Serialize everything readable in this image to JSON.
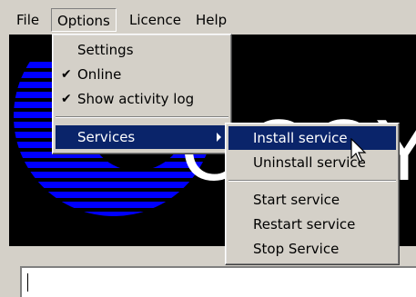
{
  "menubar": {
    "items": [
      {
        "label": "File"
      },
      {
        "label": "Options"
      },
      {
        "label": "Licence"
      },
      {
        "label": "Help"
      }
    ]
  },
  "options_menu": {
    "items": [
      {
        "label": "Settings",
        "checked": false
      },
      {
        "label": "Online",
        "checked": true
      },
      {
        "label": "Show activity log",
        "checked": true
      },
      {
        "label": "Services",
        "has_submenu": true,
        "highlighted": true
      }
    ],
    "check_glyph": "✔"
  },
  "services_submenu": {
    "items": [
      {
        "label": "Install service",
        "highlighted": true
      },
      {
        "label": "Uninstall service"
      },
      {
        "label": "Start service"
      },
      {
        "label": "Restart service"
      },
      {
        "label": "Stop Service"
      }
    ]
  },
  "banner": {
    "text": "CCCY",
    "colors": {
      "stripe": "#0000ff",
      "background": "#000000",
      "text": "#ffffff"
    }
  },
  "colors": {
    "menu_face": "#d4d0c8",
    "highlight": "#0a246a",
    "highlight_text": "#ffffff"
  },
  "activity_log": {
    "value": ""
  }
}
